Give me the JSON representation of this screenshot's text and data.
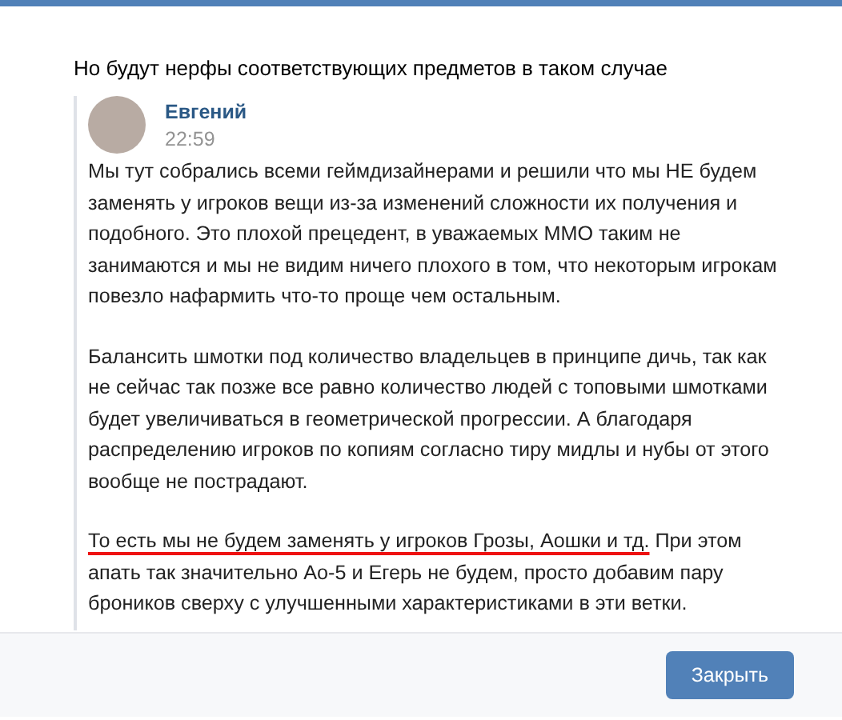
{
  "message": {
    "text": "Но будут нерфы соответствующих предметов в таком случае"
  },
  "quote": {
    "author": "Евгений",
    "time": "22:59",
    "paragraphs": [
      {
        "segments": [
          {
            "text": "Мы тут собрались всеми геймдизайнерами и решили что мы НЕ будем заменять у игроков вещи из-за изменений сложности их получения и подобного. Это плохой прецедент, в уважаемых ММО таким не занимаются и мы не видим ничего плохого в том, что некоторым игрокам повезло нафармить что-то проще чем остальным.",
            "underlined": false
          }
        ]
      },
      {
        "segments": [
          {
            "text": "Балансить шмотки под количество владельцев в принципе дичь, так как не сейчас так позже все равно количество людей с топовыми шмотками будет увеличиваться в геометрической прогрессии. А благодаря распределению игроков по копиям согласно тиру мидлы и нубы от этого вообще не пострадают.",
            "underlined": false
          }
        ]
      },
      {
        "segments": [
          {
            "text": "То есть мы не будем заменять у игроков Грозы, Аошки и тд.",
            "underlined": true
          },
          {
            "text": " При этом апать так значительно Ао-5 и Егерь не будем, просто добавим пару броников сверху с улучшенными характеристиками в эти ветки.",
            "underlined": false
          }
        ]
      }
    ]
  },
  "footer": {
    "button": "Закрыть"
  }
}
